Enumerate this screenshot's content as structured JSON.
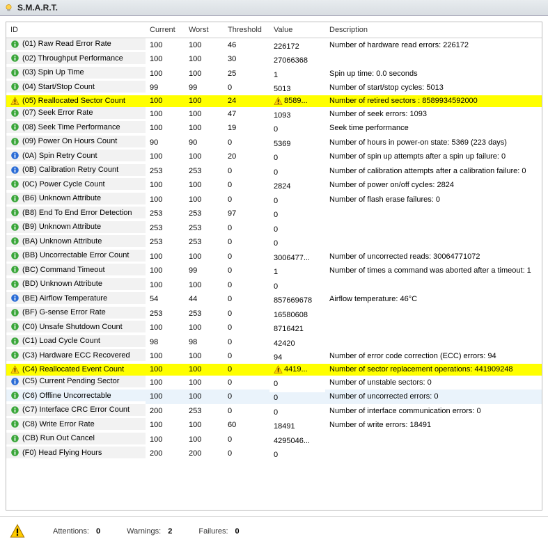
{
  "title": "S.M.A.R.T.",
  "columns": [
    "ID",
    "Current",
    "Worst",
    "Threshold",
    "Value",
    "Description"
  ],
  "rows": [
    {
      "icon": "info-green",
      "id": "(01) Raw Read Error Rate",
      "current": "100",
      "worst": "100",
      "threshold": "46",
      "value": "226172",
      "desc": "Number of hardware read errors: 226172"
    },
    {
      "icon": "info-green",
      "id": "(02) Throughput Performance",
      "current": "100",
      "worst": "100",
      "threshold": "30",
      "value": "27066368",
      "desc": ""
    },
    {
      "icon": "info-green",
      "id": "(03) Spin Up Time",
      "current": "100",
      "worst": "100",
      "threshold": "25",
      "value": "1",
      "desc": "Spin up time: 0.0 seconds"
    },
    {
      "icon": "info-green",
      "id": "(04) Start/Stop Count",
      "current": "99",
      "worst": "99",
      "threshold": "0",
      "value": "5013",
      "desc": "Number of start/stop cycles: 5013"
    },
    {
      "icon": "warn",
      "id": "(05) Reallocated Sector Count",
      "current": "100",
      "worst": "100",
      "threshold": "24",
      "value": "8589...",
      "valicon": "warn",
      "desc": "Number of retired sectors : 8589934592000",
      "rowclass": "warn"
    },
    {
      "icon": "info-green",
      "id": "(07) Seek Error Rate",
      "current": "100",
      "worst": "100",
      "threshold": "47",
      "value": "1093",
      "desc": "Number of seek errors: 1093"
    },
    {
      "icon": "info-green",
      "id": "(08) Seek Time Performance",
      "current": "100",
      "worst": "100",
      "threshold": "19",
      "value": "0",
      "desc": "Seek time performance"
    },
    {
      "icon": "info-green",
      "id": "(09) Power On Hours Count",
      "current": "90",
      "worst": "90",
      "threshold": "0",
      "value": "5369",
      "desc": "Number of hours in power-on state: 5369 (223 days)"
    },
    {
      "icon": "info-blue",
      "id": "(0A) Spin Retry Count",
      "current": "100",
      "worst": "100",
      "threshold": "20",
      "value": "0",
      "desc": "Number of spin up attempts after a spin up failure: 0"
    },
    {
      "icon": "info-blue",
      "id": "(0B) Calibration Retry Count",
      "current": "253",
      "worst": "253",
      "threshold": "0",
      "value": "0",
      "desc": "Number of calibration attempts after a calibration failure: 0"
    },
    {
      "icon": "info-green",
      "id": "(0C) Power Cycle Count",
      "current": "100",
      "worst": "100",
      "threshold": "0",
      "value": "2824",
      "desc": "Number of power on/off cycles: 2824"
    },
    {
      "icon": "info-green",
      "id": "(B6) Unknown Attribute",
      "current": "100",
      "worst": "100",
      "threshold": "0",
      "value": "0",
      "desc": "Number of flash erase failures: 0"
    },
    {
      "icon": "info-green",
      "id": "(B8) End To End Error Detection",
      "current": "253",
      "worst": "253",
      "threshold": "97",
      "value": "0",
      "desc": ""
    },
    {
      "icon": "info-green",
      "id": "(B9) Unknown Attribute",
      "current": "253",
      "worst": "253",
      "threshold": "0",
      "value": "0",
      "desc": ""
    },
    {
      "icon": "info-green",
      "id": "(BA) Unknown Attribute",
      "current": "253",
      "worst": "253",
      "threshold": "0",
      "value": "0",
      "desc": ""
    },
    {
      "icon": "info-green",
      "id": "(BB) Uncorrectable Error Count",
      "current": "100",
      "worst": "100",
      "threshold": "0",
      "value": "3006477...",
      "desc": "Number of uncorrected reads: 30064771072"
    },
    {
      "icon": "info-green",
      "id": "(BC) Command Timeout",
      "current": "100",
      "worst": "99",
      "threshold": "0",
      "value": "1",
      "desc": "Number of times a command was aborted after a timeout: 1"
    },
    {
      "icon": "info-green",
      "id": "(BD) Unknown Attribute",
      "current": "100",
      "worst": "100",
      "threshold": "0",
      "value": "0",
      "desc": ""
    },
    {
      "icon": "info-blue",
      "id": "(BE) Airflow Temperature",
      "current": "54",
      "worst": "44",
      "threshold": "0",
      "value": "857669678",
      "desc": "Airflow temperature: 46°C"
    },
    {
      "icon": "info-green",
      "id": "(BF) G-sense Error Rate",
      "current": "253",
      "worst": "253",
      "threshold": "0",
      "value": "16580608",
      "desc": ""
    },
    {
      "icon": "info-green",
      "id": "(C0) Unsafe Shutdown Count",
      "current": "100",
      "worst": "100",
      "threshold": "0",
      "value": "8716421",
      "desc": ""
    },
    {
      "icon": "info-green",
      "id": "(C1) Load Cycle Count",
      "current": "98",
      "worst": "98",
      "threshold": "0",
      "value": "42420",
      "desc": ""
    },
    {
      "icon": "info-green",
      "id": "(C3) Hardware ECC Recovered",
      "current": "100",
      "worst": "100",
      "threshold": "0",
      "value": "94",
      "desc": "Number of error code correction (ECC) errors: 94"
    },
    {
      "icon": "warn",
      "id": "(C4) Reallocated Event Count",
      "current": "100",
      "worst": "100",
      "threshold": "0",
      "value": "4419...",
      "valicon": "warn",
      "desc": "Number of sector replacement operations: 441909248",
      "rowclass": "warn"
    },
    {
      "icon": "info-blue",
      "id": "(C5) Current Pending Sector",
      "current": "100",
      "worst": "100",
      "threshold": "0",
      "value": "0",
      "desc": "Number of unstable sectors: 0"
    },
    {
      "icon": "info-green",
      "id": "(C6) Offline Uncorrectable",
      "current": "100",
      "worst": "100",
      "threshold": "0",
      "value": "0",
      "desc": "Number of uncorrected errors: 0",
      "rowclass": "hover"
    },
    {
      "icon": "info-green",
      "id": "(C7) Interface CRC Error Count",
      "current": "200",
      "worst": "253",
      "threshold": "0",
      "value": "0",
      "desc": "Number of interface communication errors: 0"
    },
    {
      "icon": "info-green",
      "id": "(C8) Write Error Rate",
      "current": "100",
      "worst": "100",
      "threshold": "60",
      "value": "18491",
      "desc": "Number of write errors: 18491"
    },
    {
      "icon": "info-green",
      "id": "(CB) Run Out Cancel",
      "current": "100",
      "worst": "100",
      "threshold": "0",
      "value": "4295046...",
      "desc": ""
    },
    {
      "icon": "info-green",
      "id": "(F0) Head Flying Hours",
      "current": "200",
      "worst": "200",
      "threshold": "0",
      "value": "0",
      "desc": ""
    }
  ],
  "footer": {
    "attentions_label": "Attentions:",
    "attentions": "0",
    "warnings_label": "Warnings:",
    "warnings": "2",
    "failures_label": "Failures:",
    "failures": "0"
  }
}
